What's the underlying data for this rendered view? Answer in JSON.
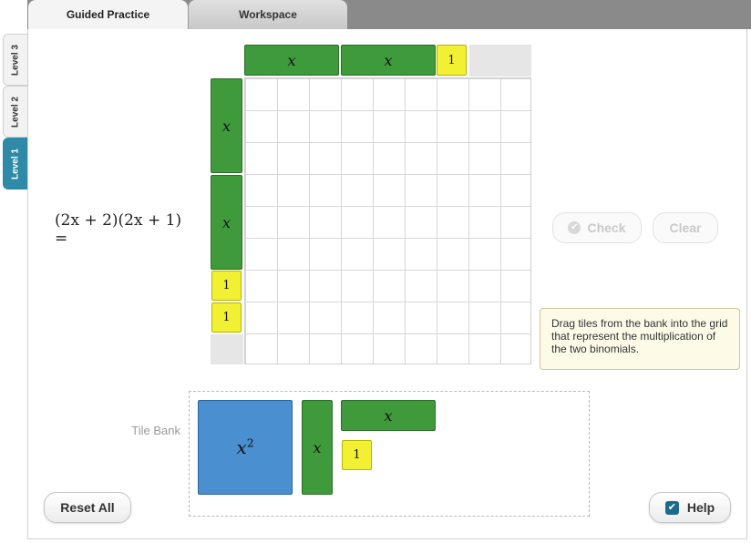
{
  "tabs": [
    {
      "label": "Guided Practice",
      "active": true
    },
    {
      "label": "Workspace",
      "active": false
    }
  ],
  "levels": [
    {
      "label": "Level 3",
      "active": false
    },
    {
      "label": "Level 2",
      "active": false
    },
    {
      "label": "Level 1",
      "active": true
    }
  ],
  "equation": "(2x + 2)(2x + 1) =",
  "grid": {
    "columns": 9,
    "rows": 9,
    "top_tiles": [
      "x",
      "x",
      "1"
    ],
    "left_tiles": [
      "x",
      "x",
      "1",
      "1"
    ]
  },
  "buttons": {
    "check": "Check",
    "clear": "Clear",
    "reset": "Reset All",
    "help": "Help"
  },
  "hint": "Drag tiles from the bank into the grid that represent the multiplication of the two binomials.",
  "tile_bank": {
    "label": "Tile Bank",
    "tiles": [
      "x",
      "x",
      "x",
      "1"
    ]
  },
  "colors": {
    "x_tile": "#3e9a3a",
    "unit_tile": "#f2f033",
    "x2_tile": "#4a8fcf",
    "active_level": "#2f8aa7"
  },
  "icons": {
    "check_status": "check-circle-icon",
    "help_toggle": "checkbox-checked-icon"
  },
  "help_checked": true
}
